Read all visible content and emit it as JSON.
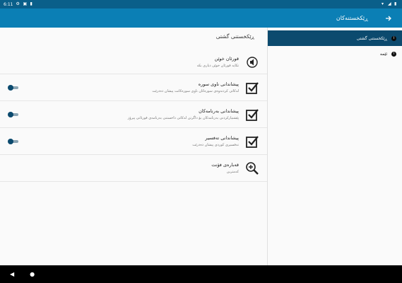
{
  "status_bar": {
    "time": "6:11",
    "icons": [
      "settings-icon",
      "shield-icon",
      "sim-icon"
    ],
    "right_icons": [
      "wifi-icon",
      "signal-icon",
      "battery-icon"
    ]
  },
  "app_bar": {
    "title": "ڕێکخستنەکان",
    "back_icon": "arrow-right-icon"
  },
  "sidebar": {
    "items": [
      {
        "label": "ڕێکخستنی گشتی",
        "active": true
      },
      {
        "label": "ئێمە",
        "active": false
      }
    ]
  },
  "main": {
    "section_title": "ڕێکخستنی گشتی",
    "prefs": [
      {
        "title": "قورئان خوێن",
        "subtitle": "تکایە قورئان خوێن دیاری بکە",
        "icon": "speaker-icon",
        "has_toggle": false
      },
      {
        "title": "پیشاندانی ناوی سورە",
        "subtitle": "لەکاتی کردنەوەی سورەکان ناوی سورەکانت پیشان دەدرێت",
        "icon": "checkbox-icon",
        "has_toggle": true,
        "enabled": false
      },
      {
        "title": "پیشاندانی بەرنامەکان",
        "subtitle": "پێشنیارکردنی بەرنامەکان بۆ داگرتن لەکاتی داخستنی بەرنامەی قورئانی پیرۆز",
        "icon": "checkbox-icon",
        "has_toggle": true,
        "enabled": false
      },
      {
        "title": "پیشاندانی تەفسیر",
        "subtitle": "تەفسیری کوردی پیشان دەدرێت",
        "icon": "checkbox-icon",
        "has_toggle": true,
        "enabled": false
      },
      {
        "title": "قەبارەی فۆنت",
        "subtitle": "کەمترین",
        "icon": "zoom-in-icon",
        "has_toggle": false
      }
    ]
  },
  "nav_bar": {
    "back": "◀",
    "home": "●"
  }
}
